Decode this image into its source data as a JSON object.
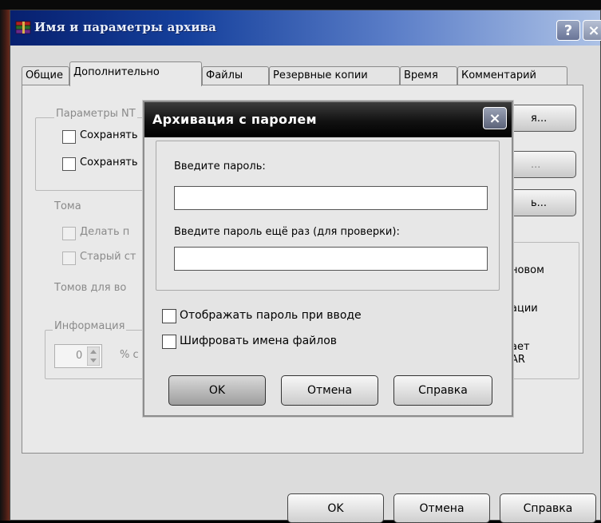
{
  "main_window": {
    "title": "Имя и параметры архива",
    "help_button": "?",
    "close_button": "×",
    "tabs": [
      "Общие",
      "Дополнительно",
      "Файлы",
      "Резервные копии",
      "Время",
      "Комментарий"
    ],
    "active_tab": "Дополнительно",
    "ntfs_group_label": "Параметры NT",
    "ntfs_check_1": "Сохранять",
    "ntfs_check_2": "Сохранять",
    "right_btn_1": "я...",
    "right_btn_2": "...",
    "right_btn_3": "ь...",
    "volumes_label": "Тома",
    "volumes_check_1": "Делать п",
    "volumes_check_2": "Старый ст",
    "volumes_count_label": "Томов для во",
    "info_label": "Информация",
    "info_spin_value": "0",
    "info_percent": "% с",
    "right_text_1": "новом",
    "right_text_2": "ации",
    "right_text_3": "ает",
    "right_text_4": "AR",
    "ok_button": "OK",
    "cancel_button": "Отмена",
    "help_btn": "Справка"
  },
  "password_dialog": {
    "title": "Архивация с паролем",
    "close_button": "×",
    "enter_password_label": "Введите пароль:",
    "password_value": "",
    "confirm_password_label": "Введите пароль ещё раз (для проверки):",
    "confirm_value": "",
    "show_password_label": "Отображать пароль при вводе",
    "encrypt_names_label": "Шифровать имена файлов",
    "ok_button": "OK",
    "cancel_button": "Отмена",
    "help_button": "Справка"
  },
  "icons": {
    "app_icon": "winrar-books-icon",
    "help_icon": "question-icon",
    "close_icon": "close-x-icon",
    "spin_icon": "spin-up-down-icon"
  }
}
